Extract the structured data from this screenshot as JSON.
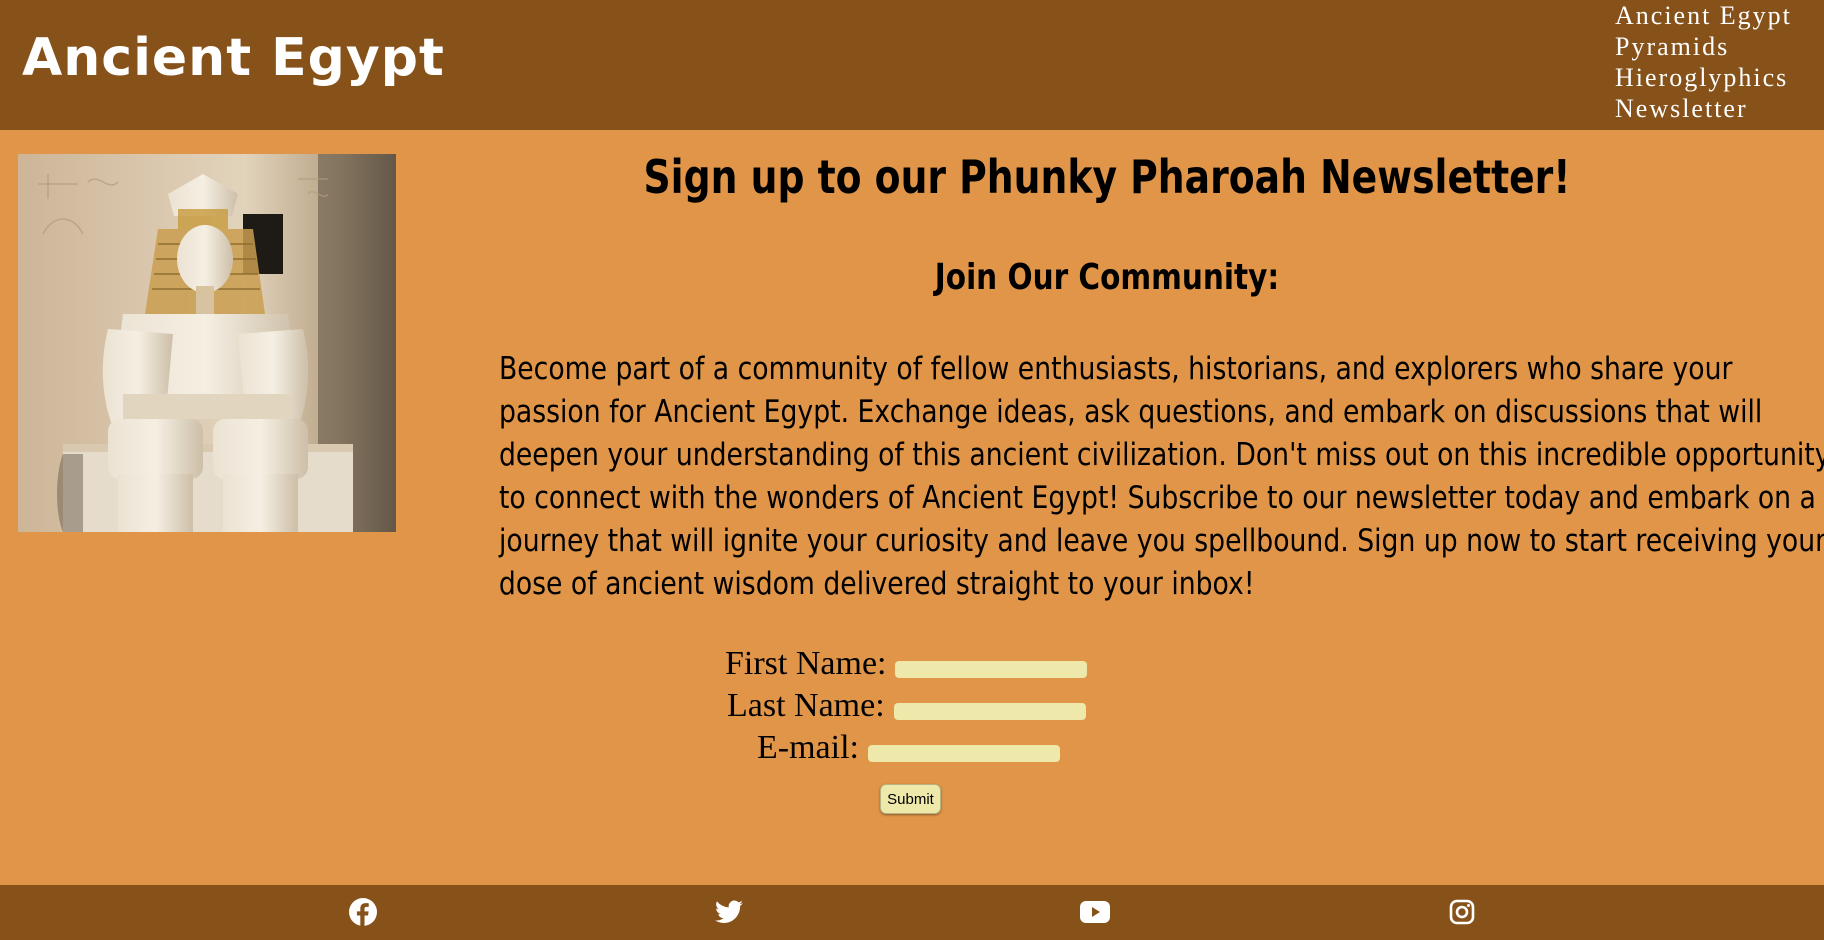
{
  "header": {
    "site_title": "Ancient Egypt",
    "nav": [
      "Ancient Egypt",
      "Pyramids",
      "Hieroglyphics",
      "Newsletter"
    ]
  },
  "main": {
    "heading": "Sign up to our Phunky Pharoah Newsletter!",
    "subheading": "Join Our Community:",
    "paragraph_lines": [
      "Become part of a community of fellow enthusiasts, historians, and explorers who share your",
      "passion for Ancient Egypt. Exchange ideas, ask questions, and embark on discussions that will",
      "deepen your understanding of this ancient civilization. Don't miss out on this incredible opportunity",
      "to connect with the wonders of Ancient Egypt! Subscribe to our newsletter today and embark on a",
      "journey that will ignite your curiosity and leave you spellbound. Sign up now to start receiving your",
      "dose of ancient wisdom delivered straight to your inbox!"
    ]
  },
  "form": {
    "first_name_label": "First Name:",
    "last_name_label": "Last Name:",
    "email_label": "E-mail:",
    "first_name_value": "",
    "last_name_value": "",
    "email_value": "",
    "submit_label": "Submit"
  },
  "footer": {
    "social_icons": [
      "facebook-icon",
      "twitter-icon",
      "youtube-icon",
      "instagram-icon"
    ]
  },
  "colors": {
    "header_bg": "#87521a",
    "page_bg": "#e09548",
    "input_bg": "#eee8aa"
  }
}
